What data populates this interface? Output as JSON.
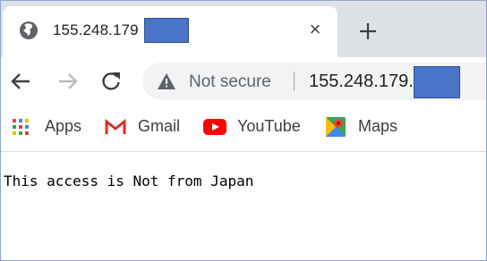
{
  "tab": {
    "title": "155.248.179",
    "close_glyph": "×",
    "favicon": "globe-icon"
  },
  "toolbar": {
    "security_label": "Not secure",
    "url": "155.248.179.",
    "icons": [
      "back-arrow-icon",
      "forward-arrow-icon",
      "reload-icon",
      "info-warning-icon",
      "plus-icon"
    ]
  },
  "bookmarks": [
    {
      "label": "Apps",
      "icon": "apps-grid-icon"
    },
    {
      "label": "Gmail",
      "icon": "gmail-icon"
    },
    {
      "label": "YouTube",
      "icon": "youtube-icon"
    },
    {
      "label": "Maps",
      "icon": "maps-icon"
    }
  ],
  "page": {
    "text": "This access is Not from Japan"
  },
  "colors": {
    "redaction": "#4a74c8",
    "tabstrip": "#dee1e6",
    "omnibox": "#f1f3f4",
    "gmail_red": "#d93025",
    "youtube_red": "#ff0000"
  }
}
